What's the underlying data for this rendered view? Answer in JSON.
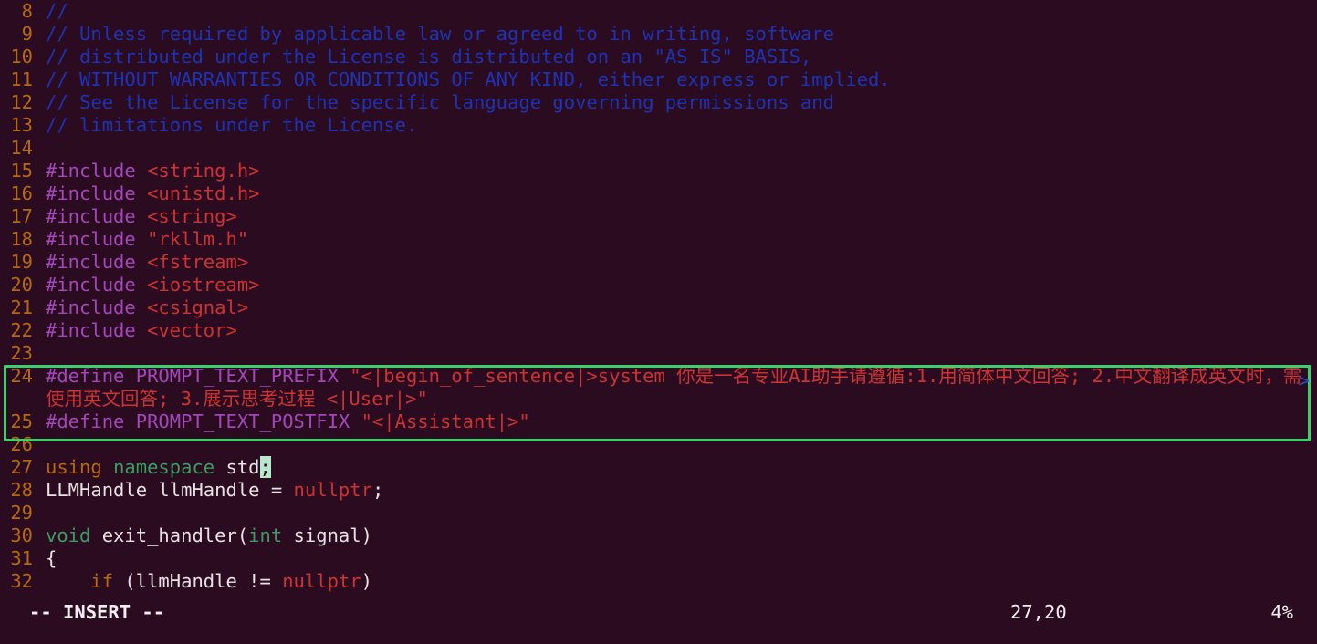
{
  "editor": {
    "app": "vim",
    "background": "#2b0b20",
    "foreground": "#e8e2e4",
    "accent_highlight": "#3ad16b",
    "cursor_color": "#b8e8cc",
    "linenumber_color": "#b4690e",
    "comment_color": "#1d33b5",
    "string_color": "#cc3333",
    "preproc_color": "#a347ba",
    "type_color": "#3b9d63",
    "keyword_color": "#b4690e"
  },
  "lines": [
    {
      "num": "8",
      "segments": [
        {
          "t": "//",
          "c": "cmt"
        }
      ]
    },
    {
      "num": "9",
      "segments": [
        {
          "t": "// Unless required by applicable law or agreed to in writing, software",
          "c": "cmt"
        }
      ]
    },
    {
      "num": "10",
      "segments": [
        {
          "t": "// distributed under the License is distributed on an \"AS IS\" BASIS,",
          "c": "cmt"
        }
      ]
    },
    {
      "num": "11",
      "segments": [
        {
          "t": "// WITHOUT WARRANTIES OR CONDITIONS OF ANY KIND, either express or implied.",
          "c": "cmt"
        }
      ]
    },
    {
      "num": "12",
      "segments": [
        {
          "t": "// See the License for the specific language governing permissions and",
          "c": "cmt"
        }
      ]
    },
    {
      "num": "13",
      "segments": [
        {
          "t": "// limitations under the License.",
          "c": "cmt"
        }
      ]
    },
    {
      "num": "14",
      "segments": []
    },
    {
      "num": "15",
      "segments": [
        {
          "t": "#include ",
          "c": "pre"
        },
        {
          "t": "<string.h>",
          "c": "str"
        }
      ]
    },
    {
      "num": "16",
      "segments": [
        {
          "t": "#include ",
          "c": "pre"
        },
        {
          "t": "<unistd.h>",
          "c": "str"
        }
      ]
    },
    {
      "num": "17",
      "segments": [
        {
          "t": "#include ",
          "c": "pre"
        },
        {
          "t": "<string>",
          "c": "str"
        }
      ]
    },
    {
      "num": "18",
      "segments": [
        {
          "t": "#include ",
          "c": "pre"
        },
        {
          "t": "\"rkllm.h\"",
          "c": "str"
        }
      ]
    },
    {
      "num": "19",
      "segments": [
        {
          "t": "#include ",
          "c": "pre"
        },
        {
          "t": "<fstream>",
          "c": "str"
        }
      ]
    },
    {
      "num": "20",
      "segments": [
        {
          "t": "#include ",
          "c": "pre"
        },
        {
          "t": "<iostream>",
          "c": "str"
        }
      ]
    },
    {
      "num": "21",
      "segments": [
        {
          "t": "#include ",
          "c": "pre"
        },
        {
          "t": "<csignal>",
          "c": "str"
        }
      ]
    },
    {
      "num": "22",
      "segments": [
        {
          "t": "#include ",
          "c": "pre"
        },
        {
          "t": "<vector>",
          "c": "str"
        }
      ]
    },
    {
      "num": "23",
      "segments": []
    },
    {
      "num": "24",
      "wrapped": true,
      "segments": [
        {
          "t": "#define ",
          "c": "pre"
        },
        {
          "t": "PROMPT_TEXT_PREFIX ",
          "c": "macroname"
        },
        {
          "t": "\"<|begin_of_sentence|>system 你是一名专业AI助手请遵循:1.用简体中文回答; 2.中文翻译成英文时，需使用英文回答; 3.展示思考过程 <|User|>\"",
          "c": "str"
        }
      ],
      "continuation_marker": ">"
    },
    {
      "num": "25",
      "segments": [
        {
          "t": "#define ",
          "c": "pre"
        },
        {
          "t": "PROMPT_TEXT_POSTFIX ",
          "c": "macroname"
        },
        {
          "t": "\"<|Assistant|>\"",
          "c": "str"
        }
      ]
    },
    {
      "num": "26",
      "segments": []
    },
    {
      "num": "27",
      "cursor_at_end": true,
      "segments": [
        {
          "t": "using ",
          "c": "kw"
        },
        {
          "t": "namespace ",
          "c": "type"
        },
        {
          "t": "std",
          "c": "plain"
        }
      ],
      "cursor_char": ";"
    },
    {
      "num": "28",
      "segments": [
        {
          "t": "LLMHandle llmHandle = ",
          "c": "plain"
        },
        {
          "t": "nullptr",
          "c": "null"
        },
        {
          "t": ";",
          "c": "plain"
        }
      ]
    },
    {
      "num": "29",
      "segments": []
    },
    {
      "num": "30",
      "segments": [
        {
          "t": "void ",
          "c": "type"
        },
        {
          "t": "exit_handler(",
          "c": "plain"
        },
        {
          "t": "int",
          "c": "type"
        },
        {
          "t": " signal)",
          "c": "plain"
        }
      ]
    },
    {
      "num": "31",
      "segments": [
        {
          "t": "{",
          "c": "plain"
        }
      ]
    },
    {
      "num": "32",
      "segments": [
        {
          "t": "    if ",
          "c": "kw"
        },
        {
          "t": "(llmHandle != ",
          "c": "plain"
        },
        {
          "t": "nullptr",
          "c": "null"
        },
        {
          "t": ")",
          "c": "plain"
        }
      ]
    }
  ],
  "statusline": {
    "mode": "-- INSERT --",
    "position": "27,20",
    "percent": "4%"
  }
}
